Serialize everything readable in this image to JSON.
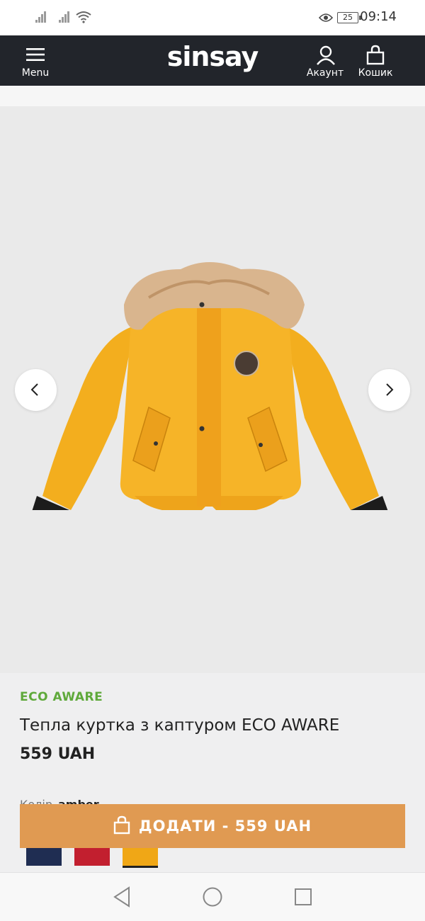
{
  "status_bar": {
    "battery": "25",
    "time": "09:14"
  },
  "header": {
    "logo": "sinsay",
    "menu_label": "Menu",
    "account_label": "Акаунт",
    "cart_label": "Кошик"
  },
  "product": {
    "image": "yellow-parka-with-fur-hood",
    "badge": "ECO AWARE",
    "title": "Тепла куртка з каптуром ECO AWARE",
    "price": "559 UAH",
    "color_label": "Колір",
    "color_value": "amber",
    "swatches": [
      {
        "name": "navy",
        "color": "#1f2d52"
      },
      {
        "name": "red",
        "color": "#c21f2f"
      },
      {
        "name": "amber",
        "color": "#f0a716",
        "selected": true
      }
    ]
  },
  "add_to_cart": {
    "label": "ДОДАТИ - 559 UAH"
  },
  "colors": {
    "header_bg": "#22252b",
    "accent_button": "#e09a52",
    "eco_green": "#5fa93b"
  }
}
